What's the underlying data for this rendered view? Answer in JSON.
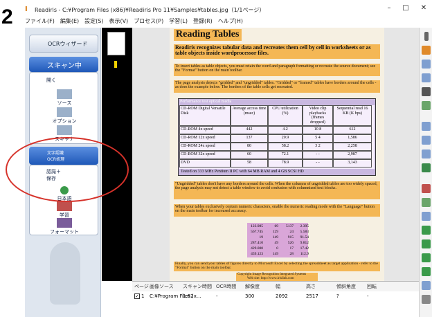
{
  "step_number": "2",
  "window": {
    "title": "Readiris - C:¥Program Files (x86)¥Readiris Pro 11¥Samples¥tables.jpg（1/1ページ）",
    "minimize": "–",
    "maximize": "□",
    "close": "✕"
  },
  "menu": [
    "ファイル(F)",
    "編集(E)",
    "設定(S)",
    "表示(V)",
    "プロセス(P)",
    "学習(L)",
    "登録(R)",
    "ヘルプ(H)"
  ],
  "left": {
    "ocr_wizard": "OCRウィザード",
    "scanning": "スキャン中",
    "open": "開く",
    "source": "ソース",
    "options": "オプション",
    "scanner": "スキャナ",
    "ocr_tab_top": "文字認識",
    "ocr_tab_bottom": "OCR処理",
    "recognize_save_1": "認識＋",
    "recognize_save_2": "保存",
    "language": "日本語",
    "learning": "学習",
    "format": "フォーマット"
  },
  "document": {
    "title": "Reading Tables",
    "p1": "Readiris recognizes tabular data and recreates them cell by cell in worksheets or as table objects inside wordprocessor files.",
    "p2": "To insert tables as table objects, you must retain the word and paragraph formatting or recreate the source document; see the \"Format\" button on the main toolbar.",
    "p3": "The page analysis detects \"gridded\" and \"ungridded\" tables. \"Gridded\" or \"framed\" tables have borders around the cells - as does the example below. The borders of the table cells get recreated.",
    "table_caption": "Performance test optical media",
    "table_headers": [
      "CD-ROM Digital Versatile Disk",
      "Average access time (msec)",
      "CPU utilization (%)",
      "Video clip playbacks (frames dropped)",
      "Sequential read 16 KB (K bps)"
    ],
    "table_rows": [
      [
        "CD-ROM 4x speed",
        "442",
        "4.2",
        "10   8",
        "612"
      ],
      [
        "CD-ROM 12x speed",
        "137",
        "20.9",
        "5   4",
        "1,586"
      ],
      [
        "CD-ROM 24x speed",
        "80",
        "58.2",
        "3   2",
        "2,258"
      ],
      [
        "CD-ROM 32x speed",
        "60",
        "72.1",
        "-   -",
        "2,987"
      ],
      [
        "DVD",
        "58",
        "78.9",
        "-   -",
        "3,143"
      ]
    ],
    "table_footer": "Tested on 333 MHz Pentium II PC with 64 MB RAM and 4 GB SCSI HD",
    "p4": "\"Ungridded\" tables don't have any borders around the cells. When the columns of ungridded tables are too widely spaced, the page analysis may not detect a table window to avoid confusion with columnized text blocks.",
    "p5": "When your tables exclusively contain numeric characters, enable the numeric reading mode with the \"Language\" button on the main toolbar for increased accuracy.",
    "numbers": [
      [
        "123.985",
        "69",
        "5137",
        "2.395"
      ],
      [
        "567.745",
        "129",
        "24",
        "5.583"
      ],
      [
        "19",
        "149",
        "915",
        "91.54"
      ],
      [
        "287.410",
        "49",
        "526",
        "9.812"
      ],
      [
        "429.000",
        "0",
        "17",
        "17.42"
      ],
      [
        "459.123",
        "149",
        "28",
        "112.9"
      ]
    ],
    "p6": "Finally, you can send your tables of figures directly to Microsoft Excel by selecting the spreadsheet as target application - refer to the \"Format\" button on the main toolbar.",
    "footer_1": "Copyright Image Recognition Integrated Systems",
    "footer_2": "Web site: http://www.irislink.com"
  },
  "bottom_table": {
    "headers": [
      "ページ",
      "画像ソース",
      "スキャン時間",
      "OCR時間",
      "解像度",
      "幅",
      "高さ",
      "傾斜角度",
      "回転"
    ],
    "row": [
      "1",
      "C:¥Program Files (x...",
      "1.62",
      "-",
      "300",
      "2092",
      "2517",
      "?",
      "-"
    ]
  },
  "colors": {
    "highlight": "#f3ad3c",
    "annotation": "#d6322a",
    "tab": "#1f58b8"
  }
}
